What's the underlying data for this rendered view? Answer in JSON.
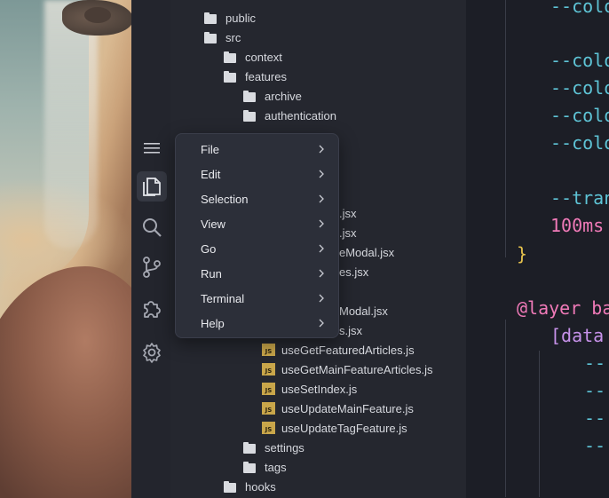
{
  "explorer": {
    "rows": [
      {
        "label": "public",
        "kind": "folder"
      },
      {
        "label": "src",
        "kind": "folder"
      },
      {
        "label": "context",
        "kind": "folder"
      },
      {
        "label": "features",
        "kind": "folder"
      },
      {
        "label": "archive",
        "kind": "folder"
      },
      {
        "label": "authentication",
        "kind": "folder"
      },
      {
        "label": ".jsx",
        "kind": "file"
      },
      {
        "label": ".jsx",
        "kind": "file"
      },
      {
        "label": "eModal.jsx",
        "kind": "file"
      },
      {
        "label": "es.jsx",
        "kind": "file"
      },
      {
        "label": "Modal.jsx",
        "kind": "file"
      },
      {
        "label": "s.jsx",
        "kind": "file"
      },
      {
        "label": "useGetFeaturedArticles.js",
        "kind": "js"
      },
      {
        "label": "useGetMainFeatureArticles.js",
        "kind": "js"
      },
      {
        "label": "useSetIndex.js",
        "kind": "js"
      },
      {
        "label": "useUpdateMainFeature.js",
        "kind": "js"
      },
      {
        "label": "useUpdateTagFeature.js",
        "kind": "js"
      },
      {
        "label": "settings",
        "kind": "folder"
      },
      {
        "label": "tags",
        "kind": "folder"
      },
      {
        "label": "hooks",
        "kind": "folder"
      }
    ],
    "js_badge": "JS"
  },
  "editor": {
    "lines": [
      "--colo",
      "--colo",
      "--colo",
      "--colo",
      "--colo",
      "--tran",
      "100ms",
      "}",
      "@layer ba",
      "[data",
      "--",
      "--",
      "--",
      "--"
    ]
  },
  "menu": {
    "items": [
      "File",
      "Edit",
      "Selection",
      "View",
      "Go",
      "Run",
      "Terminal",
      "Help"
    ]
  },
  "colors": {
    "accent_cyan": "#5ec4d6",
    "accent_pink": "#f07ab8",
    "accent_yellow": "#e6c24c",
    "accent_purple": "#c792ea"
  }
}
